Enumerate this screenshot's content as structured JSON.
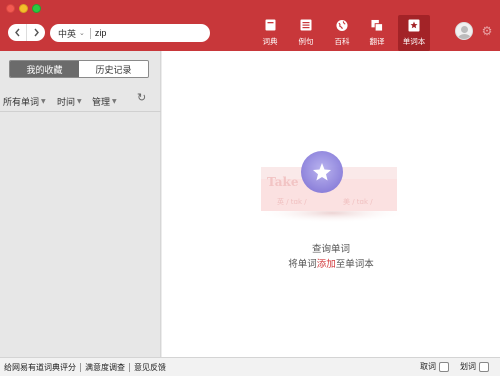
{
  "toolbar": {
    "lang_selector": "中英",
    "search_query": "zip",
    "tools": [
      {
        "label": "词典",
        "icon": "dictionary-icon"
      },
      {
        "label": "例句",
        "icon": "example-sentences-icon"
      },
      {
        "label": "百科",
        "icon": "encyclopedia-icon"
      },
      {
        "label": "翻译",
        "icon": "translate-icon"
      },
      {
        "label": "单词本",
        "icon": "wordbook-icon"
      }
    ],
    "active_tool": "单词本"
  },
  "sidebar": {
    "tabs": [
      "我的收藏",
      "历史记录"
    ],
    "active_tab": "我的收藏",
    "filters": [
      "所有单词",
      "时间",
      "管理"
    ]
  },
  "main": {
    "illustration": {
      "word": "Take",
      "pron_uk": "英 / tɑk /",
      "pron_us": "美 / tɑk /"
    },
    "empty_title": "查询单词",
    "empty_sub_before": "将单词",
    "empty_sub_link": "添加",
    "empty_sub_after": "至单词本"
  },
  "footer": {
    "links": [
      "给网易有道词典评分",
      "满意度调查",
      "意见反馈"
    ],
    "checkbox_labels": [
      "取词",
      "划词"
    ]
  },
  "colors": {
    "toolbar_red": "#c8373a",
    "active_tool_bg": "#a32327",
    "link_red": "#d23a3c"
  }
}
